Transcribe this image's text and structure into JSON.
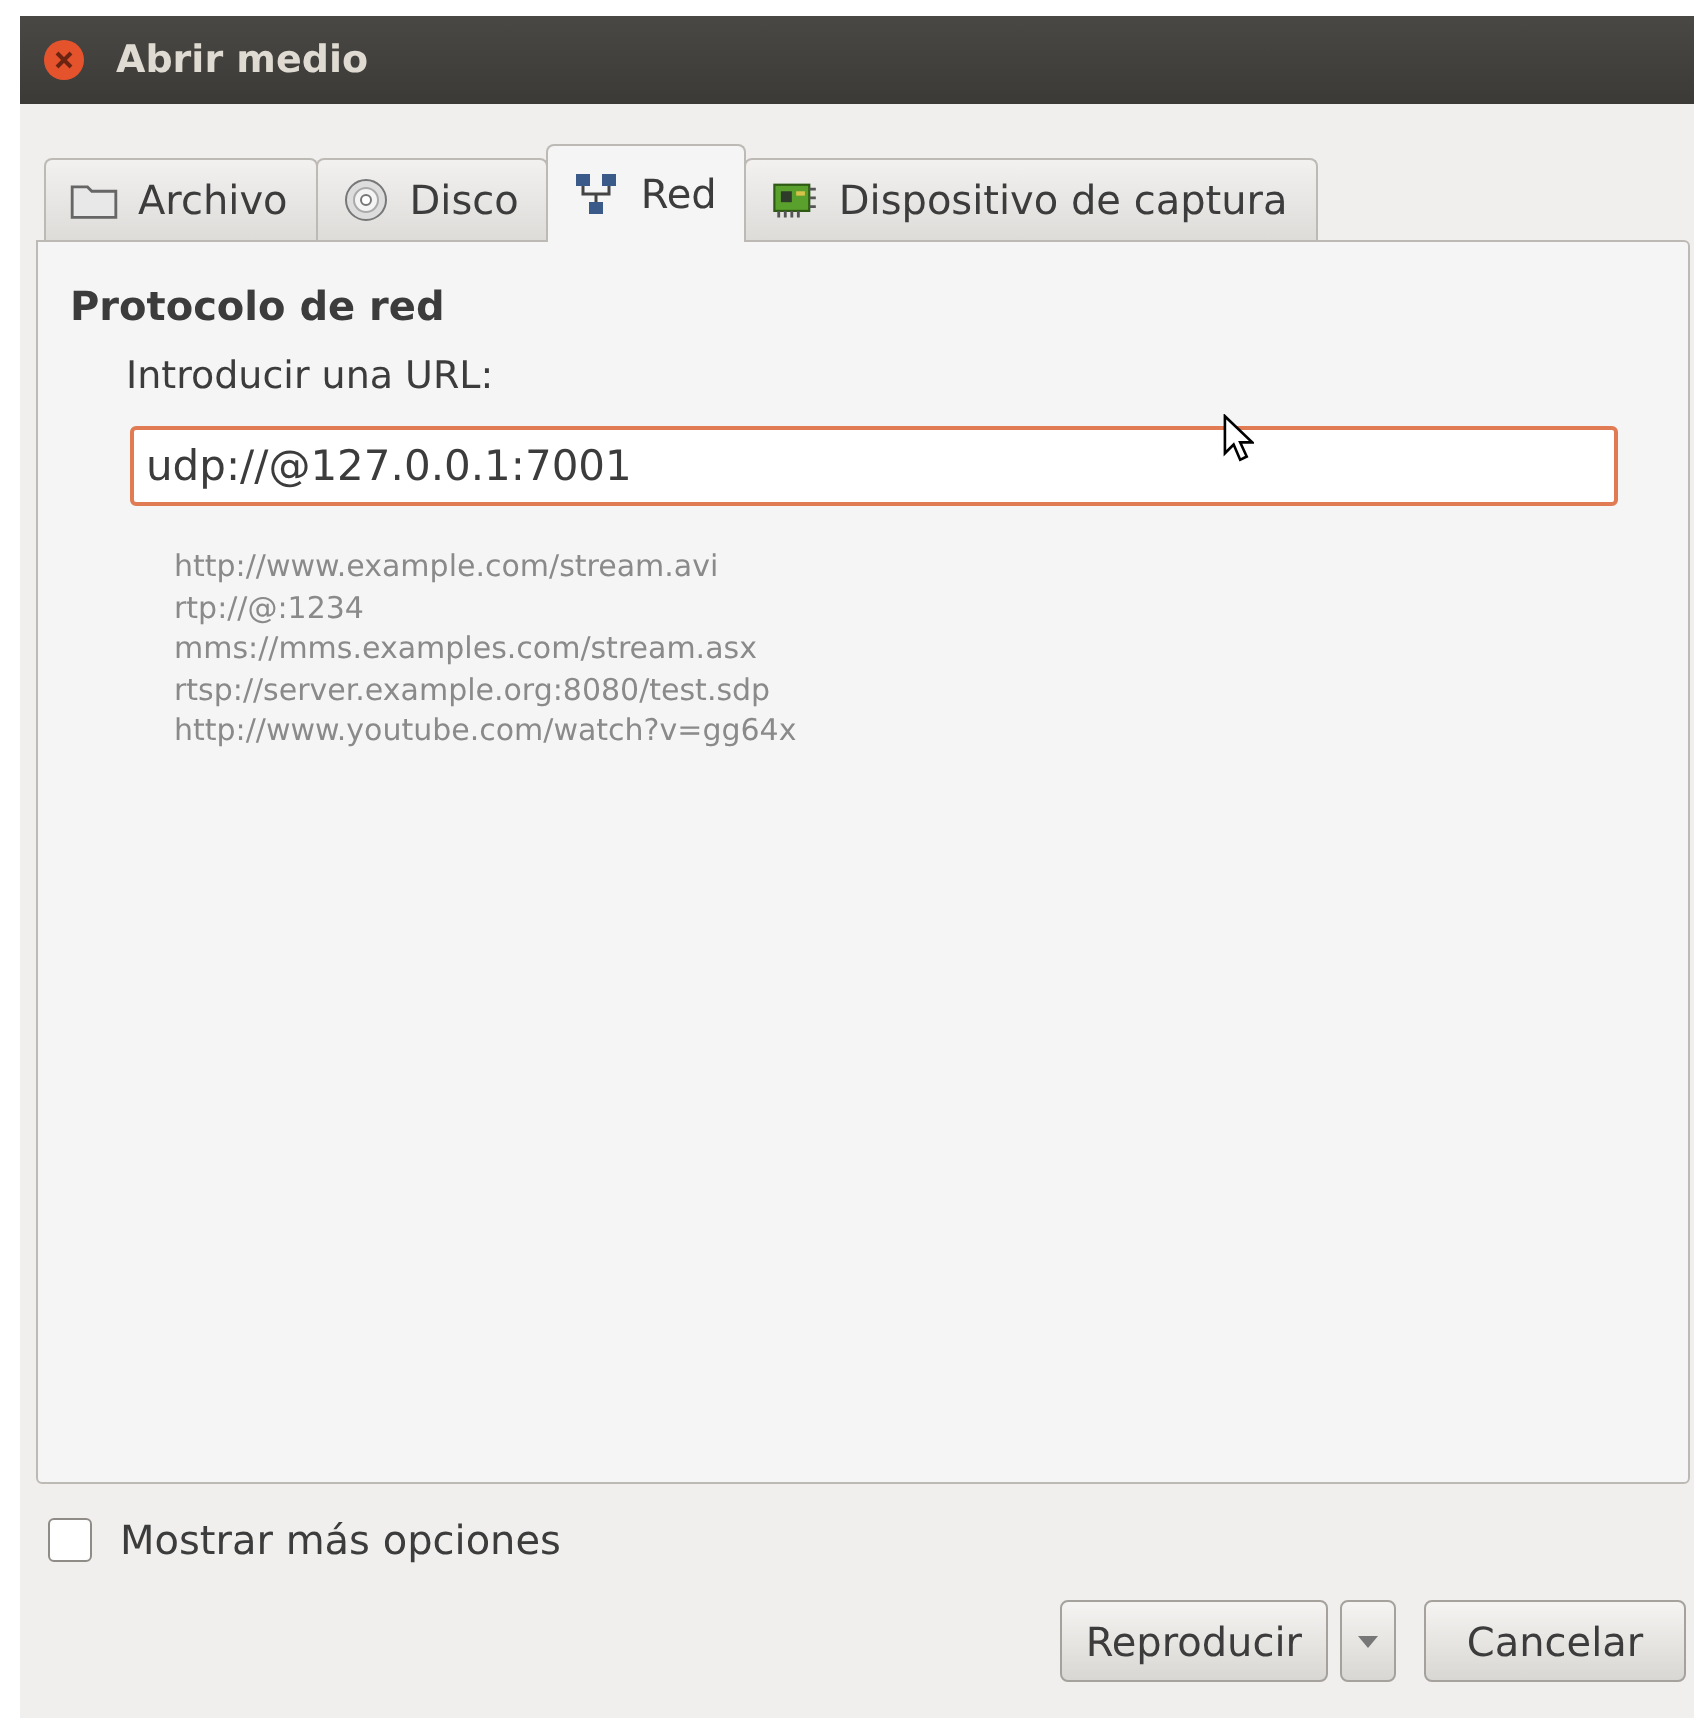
{
  "window": {
    "title": "Abrir medio"
  },
  "tabs": [
    {
      "label": "Archivo",
      "kind": "file",
      "selected": false
    },
    {
      "label": "Disco",
      "kind": "disc",
      "selected": false
    },
    {
      "label": "Red",
      "kind": "network",
      "selected": true
    },
    {
      "label": "Dispositivo de captura",
      "kind": "capture",
      "selected": false
    }
  ],
  "section": {
    "title": "Protocolo de red",
    "url_label": "Introducir una URL:",
    "url_value": "udp://@127.0.0.1:7001",
    "focused": true,
    "examples": [
      "http://www.example.com/stream.avi",
      "rtp://@:1234",
      "mms://mms.examples.com/stream.asx",
      "rtsp://server.example.org:8080/test.sdp",
      "http://www.youtube.com/watch?v=gg64x"
    ]
  },
  "more_options": {
    "label": "Mostrar más opciones",
    "checked": false
  },
  "buttons": {
    "play": "Reproducir",
    "cancel": "Cancelar"
  }
}
